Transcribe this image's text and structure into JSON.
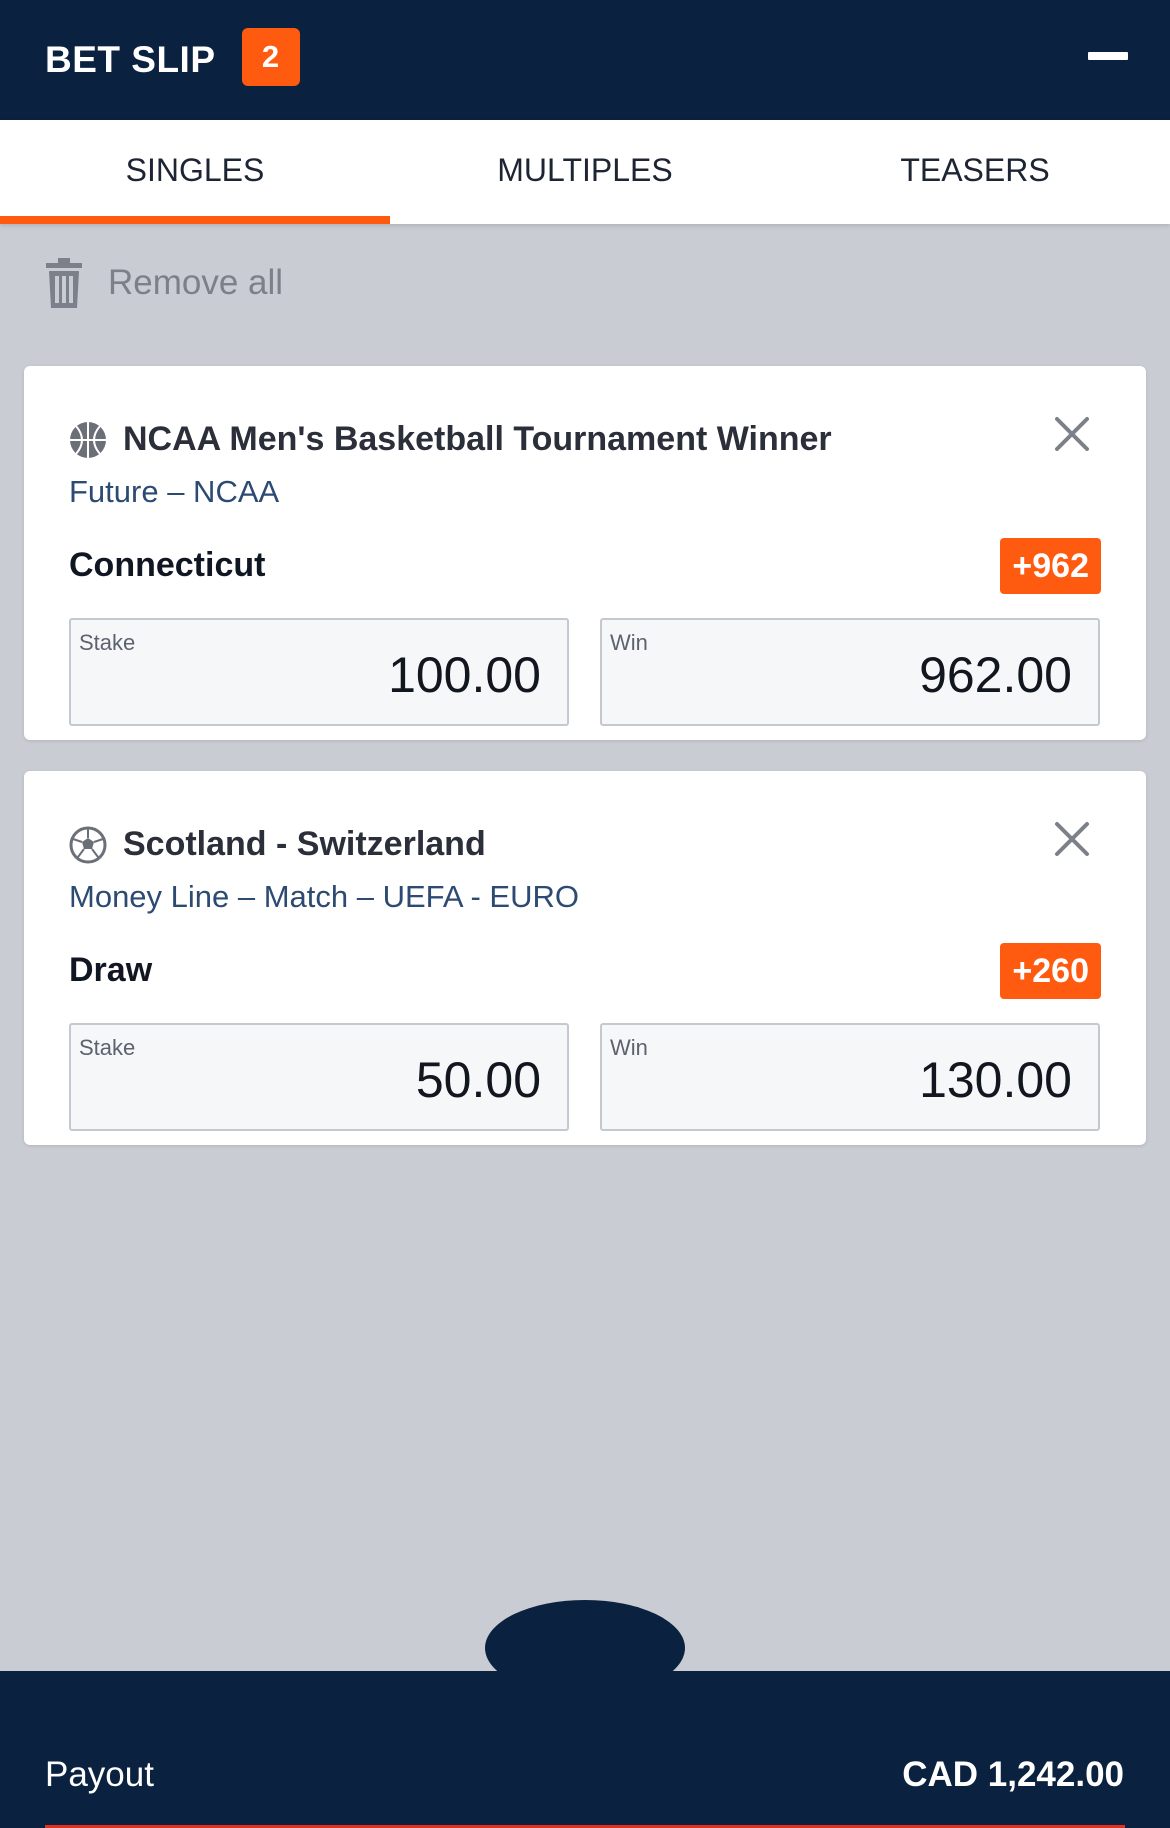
{
  "header": {
    "title": "BET SLIP",
    "count": "2",
    "minimize_icon": "minus-icon"
  },
  "tabs": [
    {
      "label": "SINGLES",
      "active": true
    },
    {
      "label": "MULTIPLES",
      "active": false
    },
    {
      "label": "TEASERS",
      "active": false
    }
  ],
  "remove_all": {
    "label": "Remove all",
    "icon": "trash-icon"
  },
  "bets": [
    {
      "sport_icon": "basketball-icon",
      "event": "NCAA Men's Basketball Tournament Winner",
      "market": "Future – NCAA",
      "selection": "Connecticut",
      "odds": "+962",
      "stake_label": "Stake",
      "stake": "100.00",
      "win_label": "Win",
      "win": "962.00"
    },
    {
      "sport_icon": "soccer-ball-icon",
      "event": "Scotland - Switzerland",
      "market": "Money Line – Match – UEFA - EURO",
      "selection": "Draw",
      "odds": "+260",
      "stake_label": "Stake",
      "stake": "50.00",
      "win_label": "Win",
      "win": "130.00"
    }
  ],
  "footer": {
    "payout_label": "Payout",
    "payout_value": "CAD 1,242.00"
  },
  "colors": {
    "navy": "#0b2140",
    "accent": "#fe5a10",
    "background": "#c9ccd3"
  }
}
